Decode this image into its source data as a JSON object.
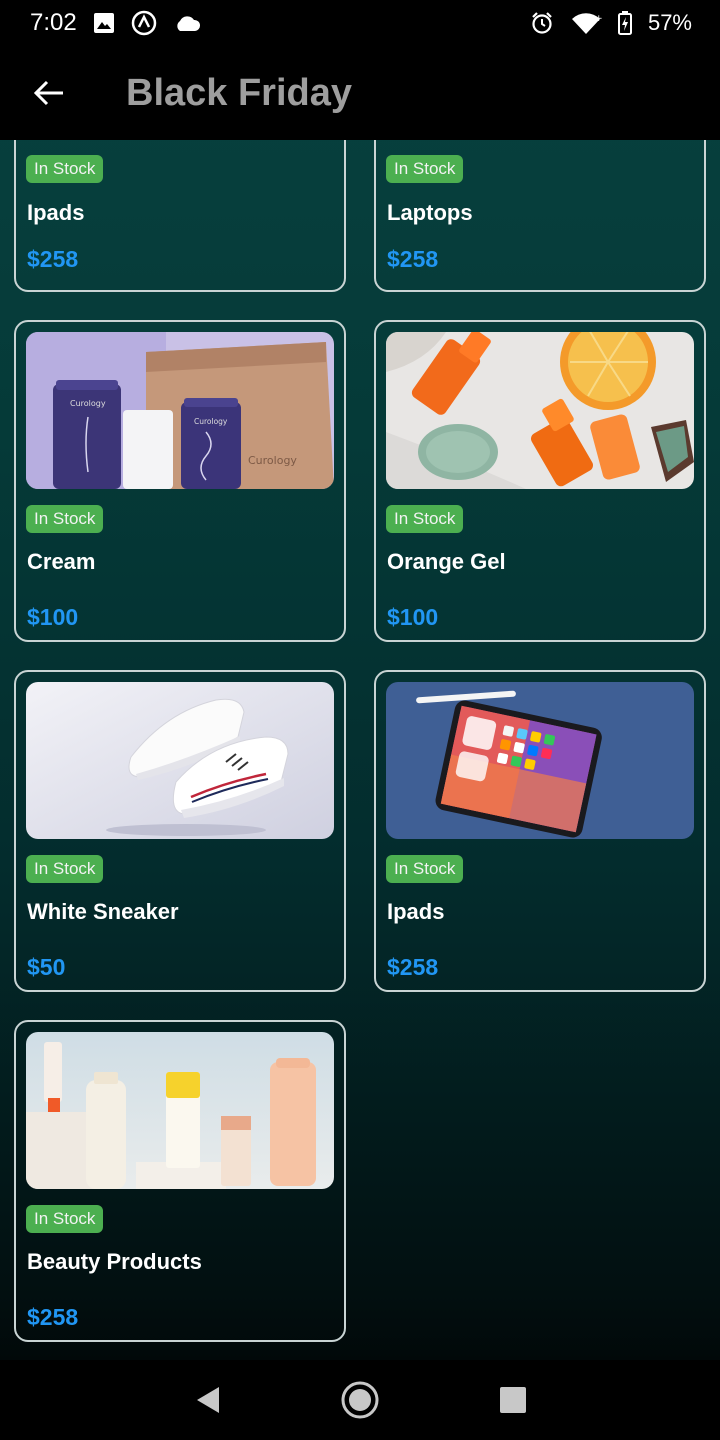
{
  "status_bar": {
    "time": "7:02",
    "battery_percent": "57%",
    "icons_left": [
      "gallery-icon",
      "vpn-icon",
      "cloud-icon"
    ],
    "icons_right": [
      "alarm-icon",
      "wifi-icon",
      "battery-charging-icon"
    ]
  },
  "app_bar": {
    "title": "Black Friday",
    "back_icon": "arrow-left-icon"
  },
  "colors": {
    "badge": "#4caf50",
    "price": "#2196f3",
    "title": "#9e9e9e"
  },
  "products": [
    {
      "name": "Ipads",
      "price": "$258",
      "stock": "In Stock",
      "image": "none-visible"
    },
    {
      "name": "Laptops",
      "price": "$258",
      "stock": "In Stock",
      "image": "none-visible"
    },
    {
      "name": "Cream",
      "price": "$100",
      "stock": "In Stock",
      "image": "cream-tubes-box"
    },
    {
      "name": "Orange Gel",
      "price": "$100",
      "stock": "In Stock",
      "image": "orange-gel-bottles"
    },
    {
      "name": "White Sneaker",
      "price": "$50",
      "stock": "In Stock",
      "image": "white-sneakers"
    },
    {
      "name": "Ipads",
      "price": "$258",
      "stock": "In Stock",
      "image": "ipad-with-pencil"
    },
    {
      "name": "Beauty Products",
      "price": "$258",
      "stock": "In Stock",
      "image": "beauty-bottles"
    }
  ],
  "image_text": {
    "cream_brand": "Curology"
  },
  "nav_bar": {
    "items": [
      "back-triangle-icon",
      "home-circle-icon",
      "recents-square-icon"
    ]
  }
}
